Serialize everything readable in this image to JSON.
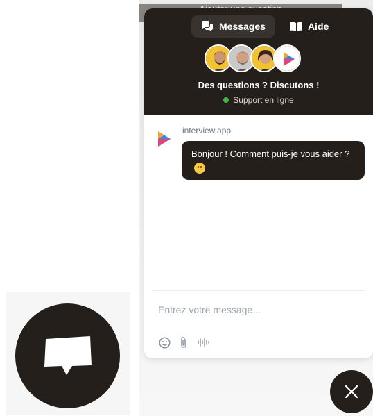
{
  "background": {
    "bar_text": "Ajouter une question"
  },
  "header": {
    "tabs": [
      {
        "label": "Messages",
        "icon": "chat-bubbles-icon",
        "active": true
      },
      {
        "label": "Aide",
        "icon": "book-icon",
        "active": false
      }
    ],
    "avatars": [
      "team-member-1",
      "team-member-2",
      "team-member-3",
      "brand-logo"
    ],
    "title": "Des questions ? Discutons !",
    "status": "Support en ligne",
    "status_color": "#3fba3f"
  },
  "conversation": {
    "sender": "interview.app",
    "message": "Bonjour ! Comment puis-je vous aider ?",
    "emoji": "smiling-face-emoji"
  },
  "composer": {
    "placeholder": "Entrez votre message...",
    "tools": [
      "emoji-icon",
      "attachment-icon",
      "voice-icon"
    ]
  },
  "colors": {
    "brand_dark": "#251f1b",
    "accent_blue": "#2a8ee8",
    "accent_pink": "#e8407a",
    "accent_orange": "#f6a535"
  }
}
